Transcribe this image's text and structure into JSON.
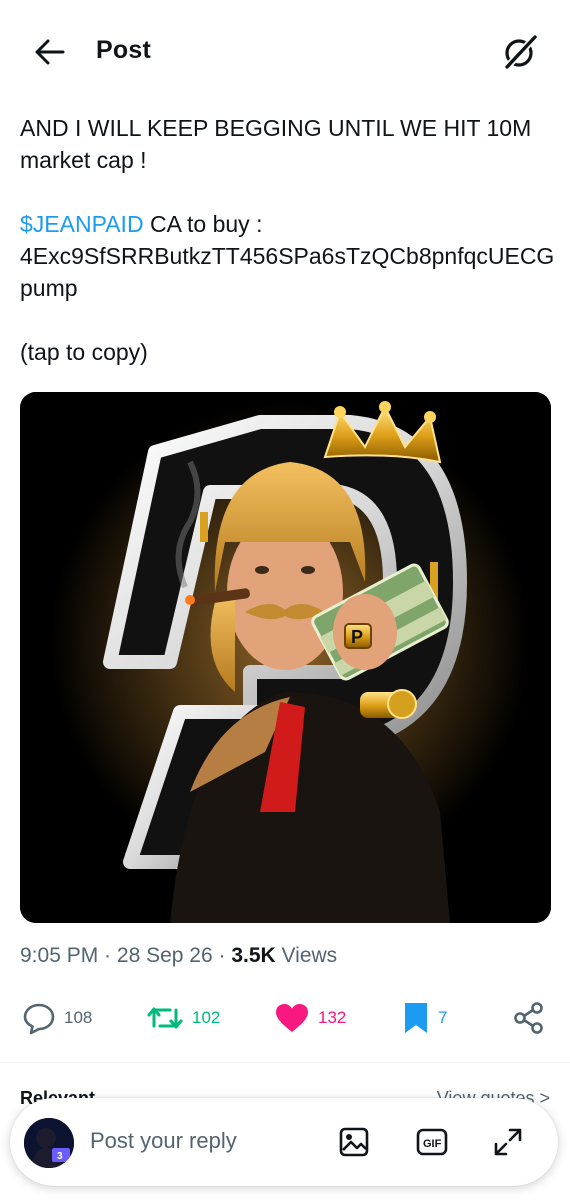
{
  "header": {
    "title": "Post",
    "back_icon": "arrow-left-icon",
    "grok_icon": "grok-slash-circle-icon"
  },
  "post": {
    "line1": "AND I WILL KEEP BEGGING UNTIL WE HIT 10M market cap !",
    "cashtag": "$JEANPAID",
    "ca_label": " CA to buy :",
    "contract_address": "4Exc9SfSRRButkzTT456SPa6sTzQCb8pnfqcUECGpump",
    "tap_hint": "(tap to copy)",
    "time": "9:05 PM",
    "sep1": " · ",
    "date": "28 Sep 26",
    "sep2": " · ",
    "views_count": "3.5K",
    "views_label": " Views"
  },
  "actions": {
    "replies": "108",
    "reposts": "102",
    "likes": "132",
    "bookmarks": "7"
  },
  "relevant": {
    "left": "Relevant",
    "right": "View quotes >"
  },
  "reply_bar": {
    "placeholder": "Post your reply"
  },
  "colors": {
    "accent": "#1d9bf0",
    "repost": "#00ba7c",
    "like": "#f91880",
    "text": "#0f1419",
    "muted": "#536471"
  }
}
